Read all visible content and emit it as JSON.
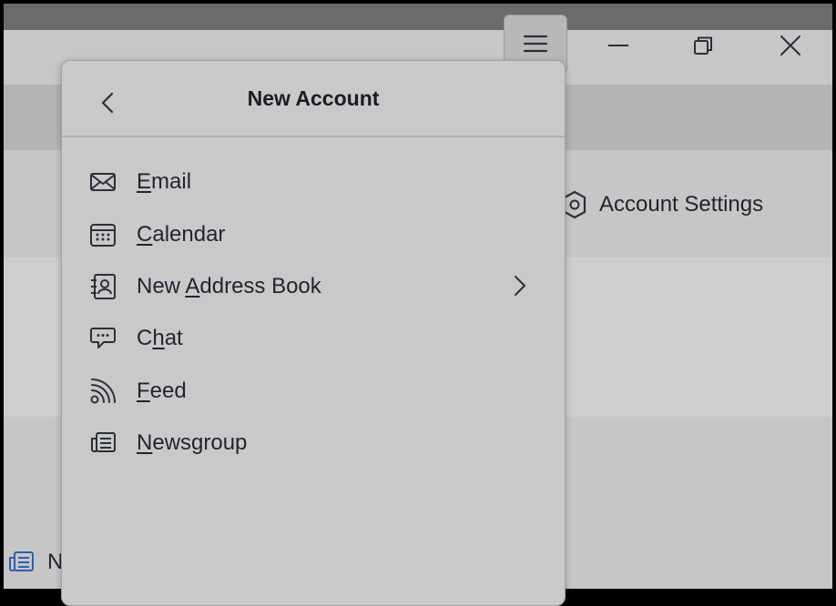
{
  "window": {
    "menu_icon": "hamburger-icon",
    "minimize_icon": "minimize-icon",
    "maximize_icon": "restore-icon",
    "close_icon": "close-icon"
  },
  "background": {
    "account_settings_label": "Account Settings",
    "partial_item_letter": "N"
  },
  "panel": {
    "title": "New Account",
    "back_icon": "chevron-left-icon",
    "items": [
      {
        "label_pre": "",
        "label_ul": "E",
        "label_post": "mail",
        "icon": "envelope-icon"
      },
      {
        "label_pre": "",
        "label_ul": "C",
        "label_post": "alendar",
        "icon": "calendar-icon"
      },
      {
        "label_pre": "New ",
        "label_ul": "A",
        "label_post": "ddress Book",
        "icon": "address-book-icon",
        "submenu": true
      },
      {
        "label_pre": "C",
        "label_ul": "h",
        "label_post": "at",
        "icon": "chat-icon"
      },
      {
        "label_pre": "",
        "label_ul": "F",
        "label_post": "eed",
        "icon": "rss-icon"
      },
      {
        "label_pre": "",
        "label_ul": "N",
        "label_post": "ewsgroup",
        "icon": "newsgroup-icon"
      }
    ]
  },
  "highlight_color": "#59e34c"
}
